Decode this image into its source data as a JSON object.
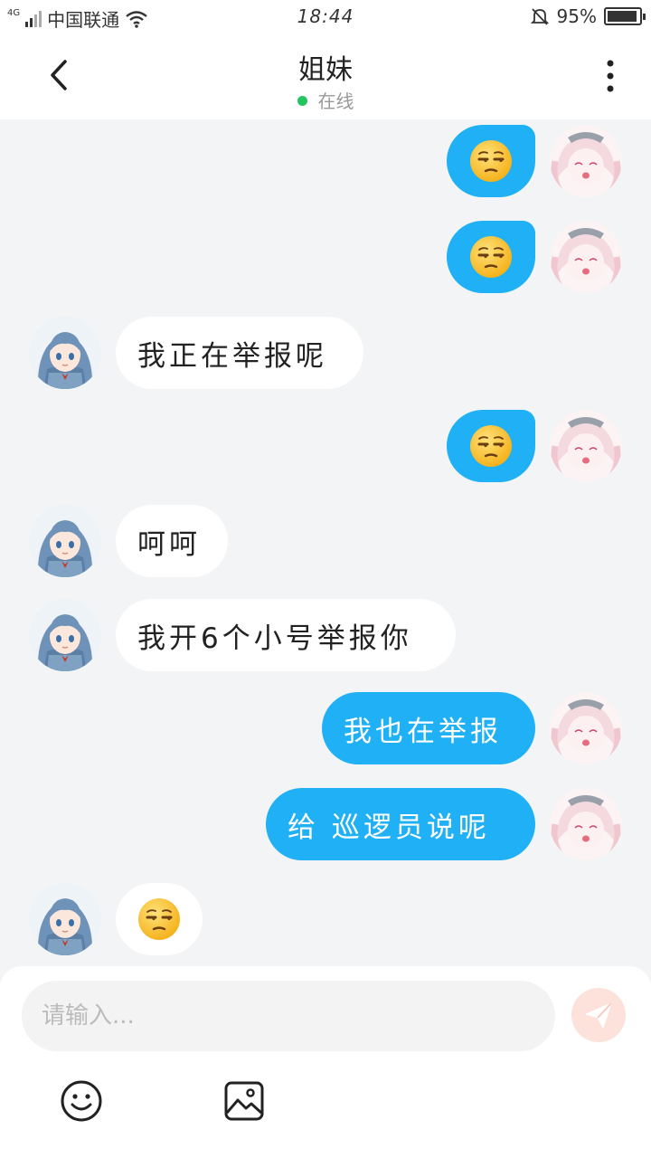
{
  "status_bar": {
    "network": "4G",
    "carrier": "中国联通",
    "time": "18:44",
    "battery_percent": "95%",
    "battery_level": 0.95
  },
  "header": {
    "title": "姐妹",
    "status": "在线"
  },
  "messages": [
    {
      "side": "out",
      "type": "emoji",
      "emoji": "unamused-face",
      "text": ""
    },
    {
      "side": "out",
      "type": "emoji",
      "emoji": "unamused-face",
      "text": ""
    },
    {
      "side": "in",
      "type": "text",
      "text": "我正在举报呢"
    },
    {
      "side": "out",
      "type": "emoji",
      "emoji": "unamused-face",
      "text": ""
    },
    {
      "side": "in",
      "type": "text",
      "text": "呵呵"
    },
    {
      "side": "in",
      "type": "text",
      "text": "我开6个小号举报你"
    },
    {
      "side": "out",
      "type": "text",
      "text": "我也在举报"
    },
    {
      "side": "out",
      "type": "text",
      "text": "给 巡逻员说呢"
    },
    {
      "side": "in",
      "type": "emoji",
      "emoji": "unamused-face",
      "text": ""
    }
  ],
  "composer": {
    "placeholder": "请输入...",
    "value": ""
  },
  "colors": {
    "accent_blue": "#1fb0f5",
    "online_green": "#22c55e",
    "send_button": "#fde2dc",
    "background": "#f3f4f6"
  },
  "icons": [
    "back-arrow-icon",
    "more-vertical-icon",
    "send-icon",
    "emoji-icon",
    "image-icon"
  ]
}
